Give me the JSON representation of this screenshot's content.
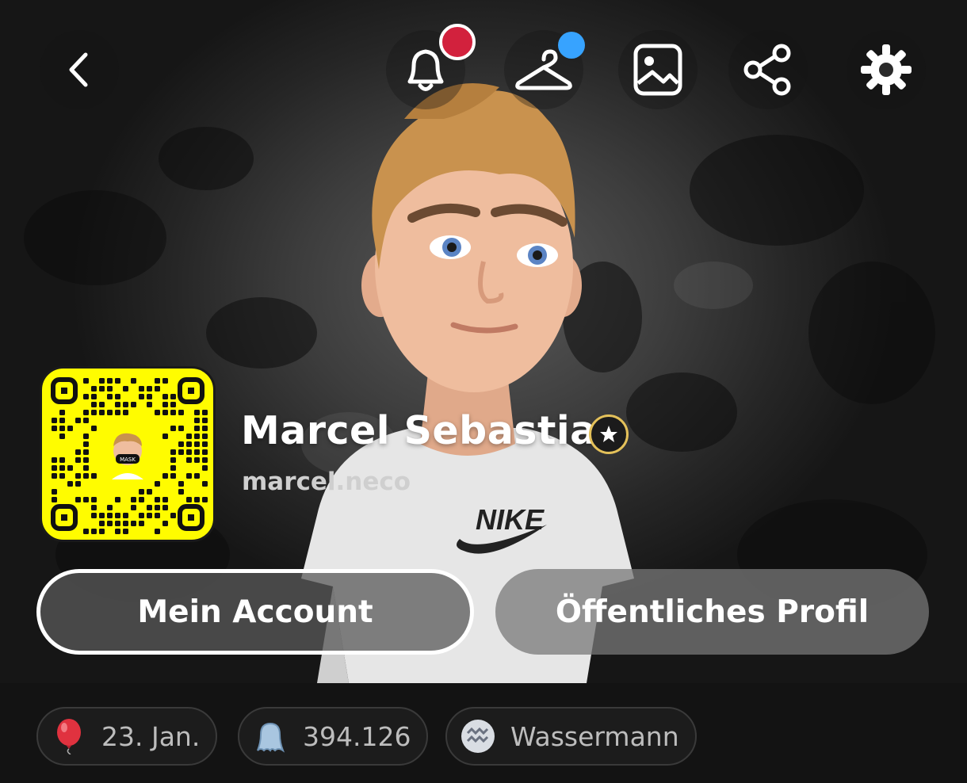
{
  "header": {
    "back_icon": "chevron-left-icon",
    "actions": [
      {
        "icon": "bell-icon",
        "badge_color": "#d2213d"
      },
      {
        "icon": "hanger-icon",
        "badge_color": "#37a3ff"
      },
      {
        "icon": "photo-icon"
      },
      {
        "icon": "share-icon"
      },
      {
        "icon": "gear-icon"
      }
    ]
  },
  "profile": {
    "display_name": "Marcel Sebastian",
    "username": "marcel.neco",
    "badge_icon": "star-icon",
    "snapcode_color": "#fffc00",
    "snapcode_mask_text": "MASK"
  },
  "buttons": {
    "my_account": "Mein Account",
    "public_profile": "Öffentliches Profil"
  },
  "chips": [
    {
      "icon": "balloon-icon",
      "label": "23. Jan."
    },
    {
      "icon": "ghost-icon",
      "label": "394.126"
    },
    {
      "icon": "aquarius-icon",
      "label": "Wassermann"
    }
  ],
  "avatar": {
    "shirt_text": "NIKE"
  }
}
